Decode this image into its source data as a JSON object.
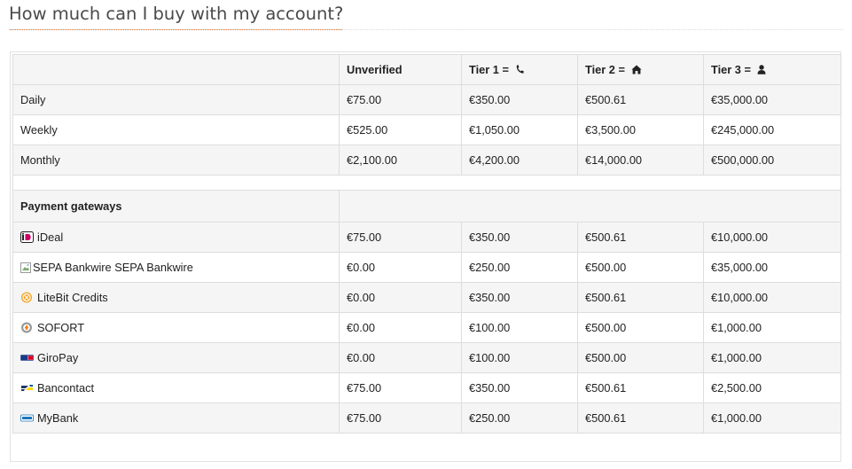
{
  "page": {
    "title": "How much can I buy with my account?"
  },
  "table": {
    "headers": [
      "",
      "Unverified",
      "Tier 1 =",
      "Tier 2 =",
      "Tier 3 ="
    ],
    "header_icons": [
      "",
      "",
      "phone-icon",
      "home-icon",
      "user-icon"
    ],
    "limits": [
      {
        "label": "Daily",
        "values": [
          "€75.00",
          "€350.00",
          "€500.61",
          "€35,000.00"
        ]
      },
      {
        "label": "Weekly",
        "values": [
          "€525.00",
          "€1,050.00",
          "€3,500.00",
          "€245,000.00"
        ]
      },
      {
        "label": "Monthly",
        "values": [
          "€2,100.00",
          "€4,200.00",
          "€14,000.00",
          "€500,000.00"
        ]
      }
    ],
    "gateways_title": "Payment gateways",
    "gateways": [
      {
        "label": "iDeal",
        "icon": "ideal-icon",
        "values": [
          "€75.00",
          "€350.00",
          "€500.61",
          "€10,000.00"
        ]
      },
      {
        "label": "SEPA Bankwire",
        "icon_alt": "SEPA Bankwire",
        "icon": "broken-image-icon",
        "values": [
          "€0.00",
          "€250.00",
          "€500.00",
          "€35,000.00"
        ]
      },
      {
        "label": "LiteBit Credits",
        "icon": "litebit-credits-icon",
        "values": [
          "€0.00",
          "€350.00",
          "€500.61",
          "€10,000.00"
        ]
      },
      {
        "label": "SOFORT",
        "icon": "sofort-icon",
        "values": [
          "€0.00",
          "€100.00",
          "€500.00",
          "€1,000.00"
        ]
      },
      {
        "label": "GiroPay",
        "icon": "giropay-icon",
        "values": [
          "€0.00",
          "€100.00",
          "€500.00",
          "€1,000.00"
        ]
      },
      {
        "label": "Bancontact",
        "icon": "bancontact-icon",
        "values": [
          "€75.00",
          "€350.00",
          "€500.61",
          "€2,500.00"
        ]
      },
      {
        "label": "MyBank",
        "icon": "mybank-icon",
        "values": [
          "€75.00",
          "€250.00",
          "€500.61",
          "€1,000.00"
        ]
      }
    ]
  },
  "colors": {
    "accent_underline": "#e87a3a",
    "row_stripe": "#f5f5f5",
    "border": "#dddddd"
  }
}
